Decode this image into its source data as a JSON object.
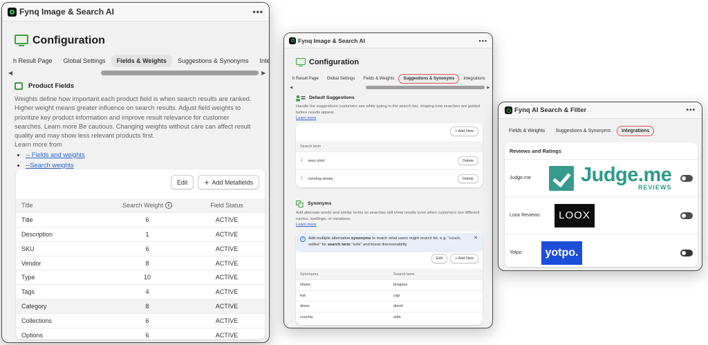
{
  "panel1": {
    "app_title": "Fynq Image & Search AI",
    "menu_dots": "•••",
    "page_title": "Configuration",
    "tabs": [
      {
        "label": "h Result Page"
      },
      {
        "label": "Global Settings"
      },
      {
        "label": "Fields & Weights",
        "selected": true
      },
      {
        "label": "Suggestions & Synonyms"
      },
      {
        "label": "Integrations"
      }
    ],
    "section_title": "Product Fields",
    "description": "Weights define how important each product field is when search results are ranked. Higher weight means greater influence on search results. Adjust field weights to prioritize key product information and improve result relevance for customer searches. Learn more Be cautious. Changing weights without care can affect result quality and may show less relevant products first.",
    "learn_more_from": "Learn more from",
    "links": [
      "-- Fields and weights",
      "--Search weights"
    ],
    "edit_label": "Edit",
    "add_metafields_label": "Add Metafields",
    "table": {
      "headers": [
        "Title",
        "Search Weight",
        "Field Status"
      ],
      "rows": [
        {
          "title": "Title",
          "weight": "6",
          "status": "ACTIVE"
        },
        {
          "title": "Description",
          "weight": "1",
          "status": "ACTIVE"
        },
        {
          "title": "SKU",
          "weight": "6",
          "status": "ACTIVE"
        },
        {
          "title": "Vendor",
          "weight": "8",
          "status": "ACTIVE"
        },
        {
          "title": "Type",
          "weight": "10",
          "status": "ACTIVE"
        },
        {
          "title": "Tags",
          "weight": "4",
          "status": "ACTIVE"
        },
        {
          "title": "Category",
          "weight": "8",
          "status": "ACTIVE"
        },
        {
          "title": "Collections",
          "weight": "6",
          "status": "ACTIVE"
        },
        {
          "title": "Options",
          "weight": "6",
          "status": "ACTIVE"
        }
      ]
    }
  },
  "panel2": {
    "app_title": "Fynq Image & Search AI",
    "menu_dots": "•••",
    "page_title": "Configuration",
    "tabs": [
      {
        "label": "h Result Page"
      },
      {
        "label": "Global Settings"
      },
      {
        "label": "Fields & Weights"
      },
      {
        "label": "Suggestions & Synonyms",
        "circled": true
      },
      {
        "label": "Integrations"
      }
    ],
    "suggestions": {
      "title": "Default Suggestions",
      "description": "Handle the suggestions customers see while typing in the search bar, shaping how searches are guided before results appear.",
      "learn_more": "Learn more",
      "add_new_label": "+ Add New",
      "column": "Search term",
      "items": [
        {
          "term": "men shirt",
          "delete": "Delete"
        },
        {
          "term": "running shoes",
          "delete": "Delete"
        }
      ]
    },
    "synonyms": {
      "title": "Synonyms",
      "description": "Add alternate words and similar terms so searches still show results even when customers use different names, spellings, or variations.",
      "learn_more": "Learn more",
      "banner": {
        "prefix": "Add multiple alternative ",
        "bold1": "synonyms",
        "middle": " to match what users might search for, e.g. \"couch, settee\" for ",
        "bold2": "search term",
        "suffix": " \"sofa\" and boost discoverability"
      },
      "edit_label": "Edit",
      "add_new_label": "+ Add New",
      "headers": [
        "Synonyms",
        "Search term"
      ],
      "rows": [
        {
          "synonym": "shoes",
          "term": "brogues"
        },
        {
          "synonym": "hat",
          "term": "cap"
        },
        {
          "synonym": "dress",
          "term": "dresh"
        },
        {
          "synonym": "couchq",
          "term": "sofa"
        }
      ]
    }
  },
  "panel3": {
    "app_title": "Fynq AI Search & Filter",
    "menu_dots": "•••",
    "tabs": [
      {
        "label": "Fields & Weights"
      },
      {
        "label": "Suggestions & Synonyms"
      },
      {
        "label": "Integrations",
        "circled": true
      }
    ],
    "card_title": "Reviews and Ratings",
    "integrations": [
      {
        "name": "Judge.me",
        "logo_text": "Judge.me",
        "logo_sub": "REVIEWS",
        "enabled": false
      },
      {
        "name": "Loox Reviews",
        "logo_text": "LOOX",
        "enabled": false
      },
      {
        "name": "Yotpo",
        "logo_text": "yotpo.",
        "enabled": false
      }
    ]
  },
  "colors": {
    "accent_green": "#3d9d43",
    "circle_red": "#e05353",
    "link_blue": "#2a62c8",
    "judge_teal": "#2c9a8b",
    "yotpo_blue": "#1d4ed8"
  }
}
